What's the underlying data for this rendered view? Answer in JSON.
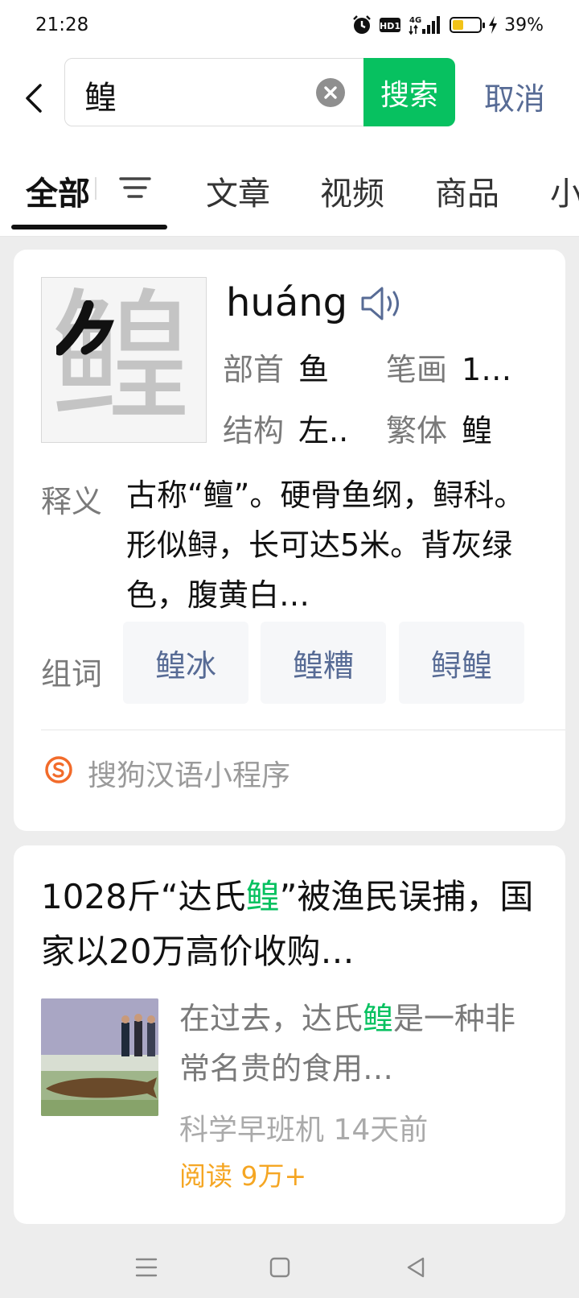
{
  "status_bar": {
    "time": "21:28",
    "network": "4G",
    "battery_percent_text": "39%",
    "battery_level": 0.39
  },
  "search": {
    "query": "鳇",
    "search_button": "搜索",
    "cancel": "取消"
  },
  "tabs": {
    "items": [
      "全部",
      "文章",
      "视频",
      "商品",
      "小"
    ],
    "active": "全部"
  },
  "dictionary": {
    "character": "鳇",
    "pinyin": "huáng",
    "radical_label": "部首",
    "radical": "鱼",
    "strokes_label": "笔画",
    "strokes": "1…",
    "structure_label": "结构",
    "structure": "左..",
    "traditional_label": "繁体",
    "traditional": "鳇",
    "definition_label": "释义",
    "definition": "古称“鳣”。硬骨鱼纲，鲟科。形似鲟，长可达5米。背灰绿色，腹黄白…",
    "words_label": "组词",
    "words": [
      "鳇冰",
      "鳇糟",
      "鲟鳇"
    ],
    "source": "搜狗汉语小程序"
  },
  "article": {
    "title_pre": "1028斤“达氏",
    "title_hl": "鳇",
    "title_post": "”被渔民误捕，国家以20万高价收购…",
    "snippet_pre": "在过去，达氏",
    "snippet_hl": "鳇",
    "snippet_post": "是一种非常名贵的食用…",
    "source": "科学早班机",
    "time": "14天前",
    "reads": "阅读 9万+"
  },
  "colors": {
    "accent_green": "#07c160",
    "link_blue": "#576b95",
    "reads_orange": "#f5a623"
  }
}
